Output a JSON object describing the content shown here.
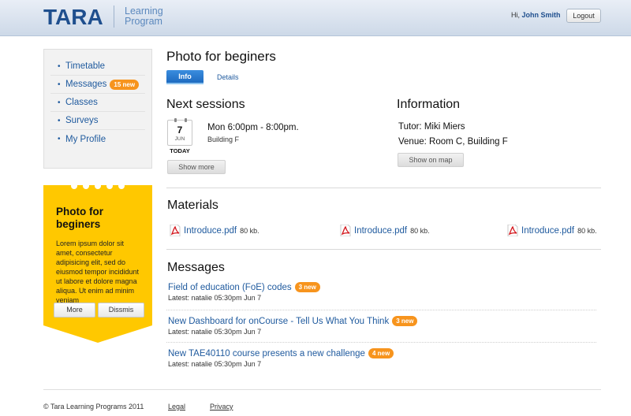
{
  "header": {
    "logo": "TARA",
    "logo_sub_line1": "Learning",
    "logo_sub_line2": "Program",
    "greeting": "Hi,",
    "user_name": "John Smith",
    "logout_label": "Logout"
  },
  "sidebar": {
    "items": [
      {
        "label": "Timetable"
      },
      {
        "label": "Messages",
        "badge": "15 new"
      },
      {
        "label": "Classes"
      },
      {
        "label": "Surveys"
      },
      {
        "label": "My Profile"
      }
    ]
  },
  "promo": {
    "title": "Photo for beginers",
    "text": "Lorem ipsum dolor sit amet, consectetur adipisicing elit, sed do eiusmod tempor incididunt ut labore et dolore magna aliqua. Ut enim ad minim veniam",
    "more_label": "More",
    "dismiss_label": "Dissmis",
    "color": "#ffc800"
  },
  "main": {
    "title": "Photo for beginers",
    "tabs": [
      {
        "label": "Info"
      },
      {
        "label": "Details"
      }
    ],
    "next_sessions": {
      "heading": "Next sessions",
      "day": "7",
      "month": "JUN",
      "today_label": "TODAY",
      "time": "Mon 6:00pm - 8:00pm.",
      "location": "Building F",
      "button": "Show more"
    },
    "information": {
      "heading": "Information",
      "tutor_label": "Tutor:",
      "tutor": "Miki Miers",
      "venue_label": "Venue:",
      "venue": "Room C, Building F",
      "button": "Show on map"
    },
    "materials": {
      "heading": "Materials",
      "files": [
        {
          "name": "Introduce.pdf",
          "size": "80 kb."
        },
        {
          "name": "Introduce.pdf",
          "size": "80 kb."
        },
        {
          "name": "Introduce.pdf",
          "size": "80 kb."
        }
      ]
    },
    "messages": {
      "heading": "Messages",
      "items": [
        {
          "title": "Field of education (FoE) codes",
          "badge": "3 new",
          "meta": "Latest: natalie 05:30pm Jun 7"
        },
        {
          "title": "New Dashboard for onCourse - Tell Us What You Think",
          "badge": "3 new",
          "meta": "Latest: natalie 05:30pm Jun 7"
        },
        {
          "title": "New TAE40110 course presents a new challenge",
          "badge": "4 new",
          "meta": "Latest: natalie 05:30pm Jun 7"
        }
      ]
    }
  },
  "footer": {
    "copyright": "© Tara Learning Programs 2011",
    "legal": "Legal",
    "privacy": "Privacy"
  },
  "colors": {
    "brand": "#1f4f8e",
    "link": "#1f5a9e",
    "badge": "#f7941d",
    "tab_active": "#1c68be"
  }
}
